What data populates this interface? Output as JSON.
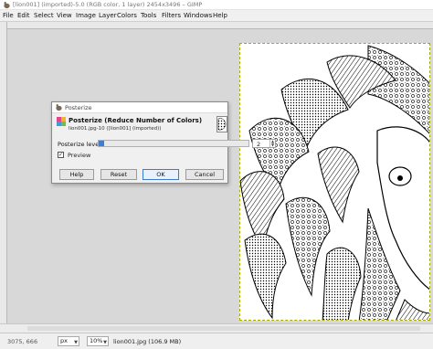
{
  "window": {
    "title": "[lion001] (imported)-5.0 (RGB color, 1 layer) 2454x3496 – GIMP"
  },
  "menubar": {
    "items": [
      "File",
      "Edit",
      "Select",
      "View",
      "Image",
      "Layer",
      "Colors",
      "Tools",
      "Filters",
      "Windows",
      "Help"
    ]
  },
  "dialog": {
    "title": "Posterize",
    "heading": "Posterize (Reduce Number of Colors)",
    "subheading": "lion001.jpg-10 ([lion001] (imported))",
    "levels_label": "Posterize levels",
    "levels_value": "2",
    "levels_fraction": 0.0,
    "preview_label": "Preview",
    "preview_checked": true,
    "buttons": {
      "help": "Help",
      "reset": "Reset",
      "ok": "OK",
      "cancel": "Cancel"
    }
  },
  "status": {
    "coords": "3075, 666",
    "unit": "px",
    "zoom": "10%",
    "message": "lion001.jpg (106.9 MB)"
  },
  "colors": {
    "accent": "#3f7fcf",
    "image_border": "#a9a900"
  },
  "icons": {
    "app": "gimp-wilber-icon",
    "posterize": "posterize-icon",
    "preview_thumb": "image-thumbnail-icon"
  }
}
